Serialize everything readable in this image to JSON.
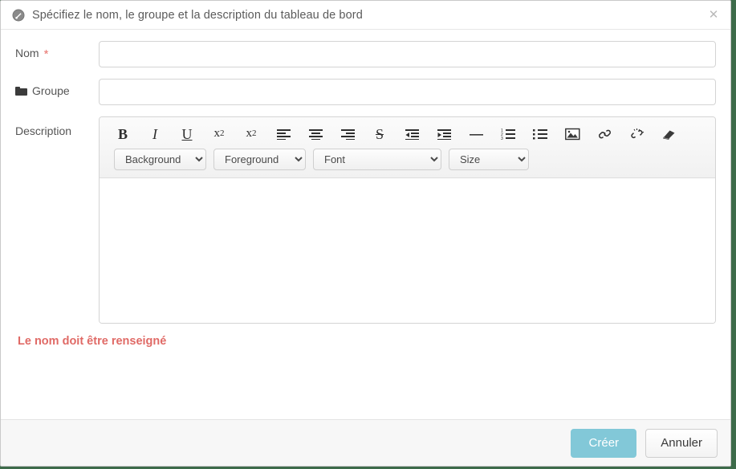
{
  "dialog": {
    "title": "Spécifiez le nom, le groupe et la description du tableau de bord",
    "title_icon": "gauge-icon",
    "close_label": "✕"
  },
  "form": {
    "name": {
      "label": "Nom",
      "required_marker": "*",
      "value": "",
      "placeholder": ""
    },
    "group": {
      "label": "Groupe",
      "icon": "folder-icon",
      "value": "",
      "placeholder": ""
    },
    "description": {
      "label": "Description",
      "value": "",
      "placeholder": ""
    }
  },
  "editor": {
    "toolbar_buttons": [
      {
        "name": "bold-icon",
        "glyph": "B",
        "title": "Bold"
      },
      {
        "name": "italic-icon",
        "glyph": "I",
        "title": "Italic"
      },
      {
        "name": "underline-icon",
        "glyph": "U",
        "title": "Underline"
      },
      {
        "name": "subscript-icon",
        "glyph": "x₂",
        "title": "Subscript"
      },
      {
        "name": "superscript-icon",
        "glyph": "x²",
        "title": "Superscript"
      },
      {
        "name": "align-left-icon",
        "glyph": "",
        "title": "Align left"
      },
      {
        "name": "align-center-icon",
        "glyph": "",
        "title": "Align center"
      },
      {
        "name": "align-right-icon",
        "glyph": "",
        "title": "Align right"
      },
      {
        "name": "strikethrough-icon",
        "glyph": "S",
        "title": "Strikethrough"
      },
      {
        "name": "outdent-icon",
        "glyph": "",
        "title": "Outdent"
      },
      {
        "name": "indent-icon",
        "glyph": "",
        "title": "Indent"
      },
      {
        "name": "horizontal-rule-icon",
        "glyph": "—",
        "title": "Horizontal rule"
      },
      {
        "name": "ordered-list-icon",
        "glyph": "",
        "title": "Ordered list"
      },
      {
        "name": "unordered-list-icon",
        "glyph": "",
        "title": "Unordered list"
      },
      {
        "name": "insert-image-icon",
        "glyph": "",
        "title": "Insert image"
      },
      {
        "name": "insert-link-icon",
        "glyph": "",
        "title": "Insert link"
      },
      {
        "name": "unlink-icon",
        "glyph": "",
        "title": "Unlink"
      },
      {
        "name": "clear-format-icon",
        "glyph": "",
        "title": "Clear formatting"
      }
    ],
    "selects": [
      {
        "name": "background-color-select",
        "label": "Background",
        "options": [
          "Background"
        ]
      },
      {
        "name": "foreground-color-select",
        "label": "Foreground",
        "options": [
          "Foreground"
        ]
      },
      {
        "name": "font-family-select",
        "label": "Font",
        "options": [
          "Font"
        ]
      },
      {
        "name": "font-size-select",
        "label": "Size",
        "options": [
          "Size"
        ]
      }
    ],
    "content": ""
  },
  "validation": {
    "error_message": "Le nom doit être renseigné"
  },
  "footer": {
    "submit_label": "Créer",
    "cancel_label": "Annuler"
  },
  "colors": {
    "primary": "#82c8d8",
    "error": "#e06a66",
    "page_background": "#3d6b4a",
    "required": "#e8736d"
  }
}
